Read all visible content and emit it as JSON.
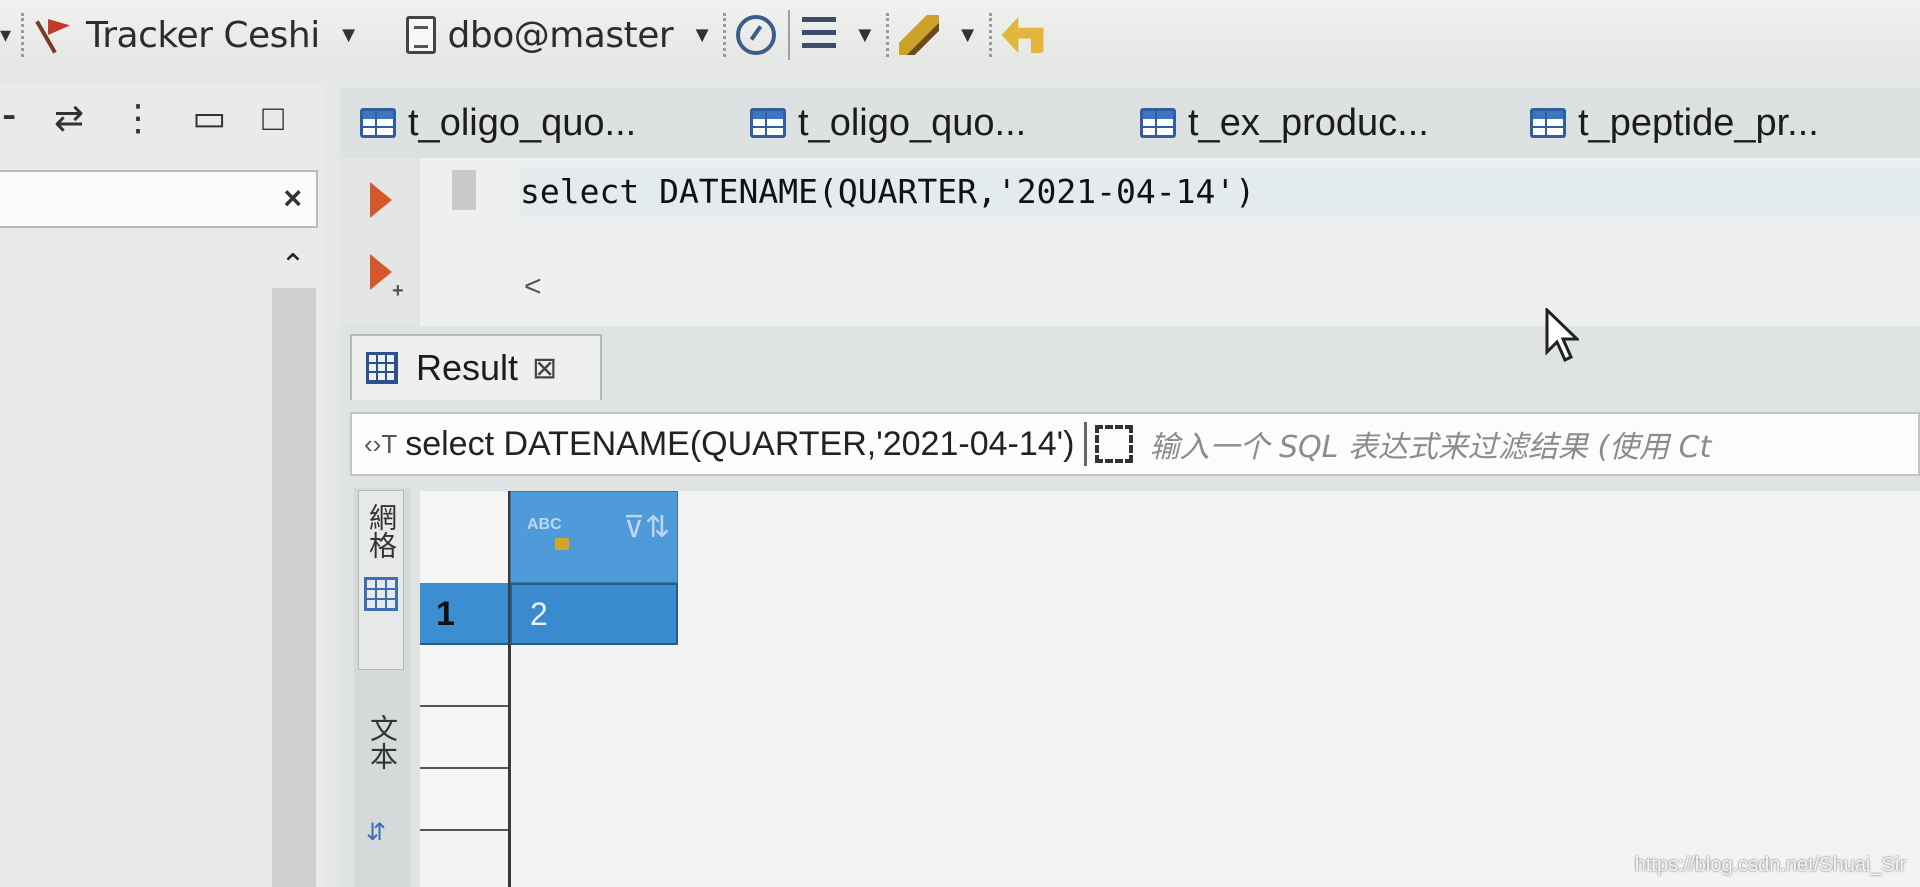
{
  "toolbar": {
    "connection": "Tracker Ceshi",
    "schema": "dbo@master"
  },
  "editor_tabs": [
    {
      "label": "t_oligo_quo..."
    },
    {
      "label": "t_oligo_quo..."
    },
    {
      "label": "t_ex_produc..."
    },
    {
      "label": "t_peptide_pr..."
    }
  ],
  "editor": {
    "code": "select DATENAME(QUARTER,'2021-04-14')",
    "scroll_indicator": "<"
  },
  "result": {
    "tab_label": "Result",
    "close_glyph": "⊠",
    "query_text": "select DATENAME(QUARTER,'2021-04-14')",
    "filter_placeholder": "输入一个 SQL 表达式来过滤结果 (使用 Ct",
    "side_panel_label": "文本",
    "column_type": "ABC",
    "rows": [
      {
        "row_num": "1",
        "value": "2"
      }
    ]
  },
  "left_panel": {
    "close_glyph": "×",
    "scroll_up": "⌃"
  },
  "watermark": "https://blog.csdn.net/Shuai_Sir",
  "colors": {
    "accent": "#3a8ad0",
    "run_button": "#d4582b"
  }
}
